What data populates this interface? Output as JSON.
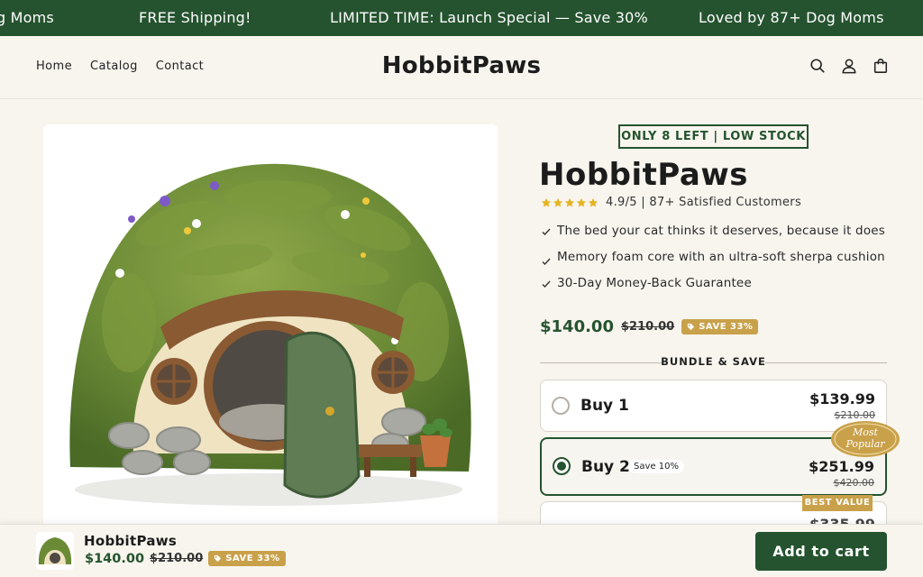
{
  "announcement": {
    "messages": [
      "g Moms",
      "FREE Shipping!",
      "LIMITED TIME: Launch Special — Save 30%",
      "Loved by 87+ Dog Moms"
    ]
  },
  "header": {
    "nav": [
      "Home",
      "Catalog",
      "Contact"
    ],
    "logo": "HobbitPaws",
    "icons": [
      "search-icon",
      "account-icon",
      "cart-icon"
    ]
  },
  "product": {
    "stock_badge": "ONLY 8 LEFT | LOW STOCK",
    "title": "HobbitPaws",
    "rating_stars": 5,
    "rating_text": "4.9/5 | 87+ Satisfied Customers",
    "benefits": [
      "The bed your cat thinks it deserves, because it does",
      "Memory foam core with an ultra-soft sherpa cushion",
      "30-Day Money-Back Guarantee"
    ],
    "price": "$140.00",
    "compare_price": "$210.00",
    "save_badge": "SAVE 33%"
  },
  "bundle": {
    "heading": "BUNDLE & SAVE",
    "options": [
      {
        "label": "Buy 1",
        "price": "$139.99",
        "compare": "$210.00",
        "selected": false
      },
      {
        "label": "Buy 2",
        "pill": "Save 10%",
        "price": "$251.99",
        "compare": "$420.00",
        "selected": true
      },
      {
        "price": "$335.99",
        "selected": false
      }
    ],
    "seal_lines": [
      "Most",
      "Popular"
    ],
    "best_value": "BEST VALUE"
  },
  "sticky_cart": {
    "title": "HobbitPaws",
    "price": "$140.00",
    "compare_price": "$210.00",
    "save_badge": "SAVE 33%",
    "button": "Add to cart"
  },
  "colors": {
    "brand_green": "#25532f",
    "gold": "#c9a14a",
    "star": "#e6b422",
    "background": "#f8f5ee"
  }
}
